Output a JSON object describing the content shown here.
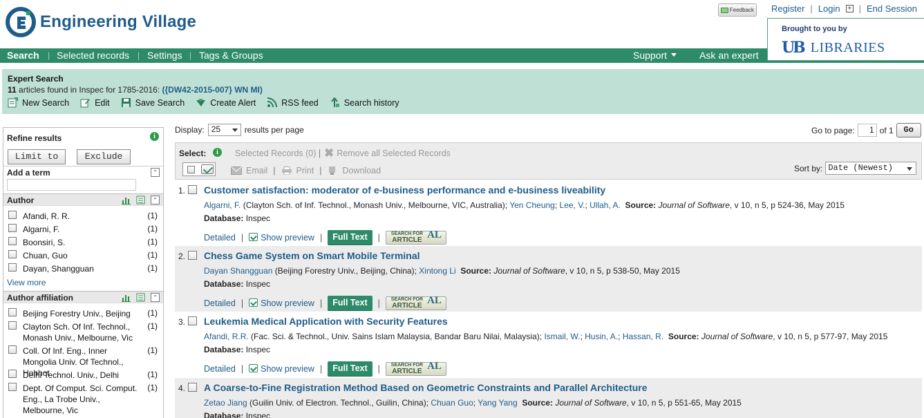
{
  "header": {
    "logo_text": "Engineering Village",
    "feedback_label": "Feedback",
    "user_links": {
      "register": "Register",
      "login": "Login",
      "plus": "+",
      "end_session": "End Session"
    },
    "brought_by": "Brought to you by",
    "library_mark": "UB",
    "library_name": "LIBRARIES"
  },
  "nav": {
    "search": "Search",
    "selected_records": "Selected records",
    "settings": "Settings",
    "tags_groups": "Tags & Groups",
    "support": "Support",
    "ask_expert": "Ask an expert",
    "separator": "|"
  },
  "expert": {
    "title": "Expert Search",
    "count": "11",
    "found_text": " articles found in Inspec for 1785-2016: ",
    "query": "({DW42-2015-007} WN MI)",
    "actions": [
      {
        "label": "New Search",
        "icon": "new-search-icon"
      },
      {
        "label": "Edit",
        "icon": "edit-icon"
      },
      {
        "label": "Save Search",
        "icon": "save-icon"
      },
      {
        "label": "Create Alert",
        "icon": "alert-icon"
      },
      {
        "label": "RSS feed",
        "icon": "rss-icon"
      },
      {
        "label": "Search history",
        "icon": "history-icon"
      }
    ]
  },
  "refine": {
    "title": "Refine results",
    "info": "i",
    "limit_to": "Limit to",
    "exclude": "Exclude",
    "add_term": "Add a term",
    "add_term_value": "",
    "author": {
      "title": "Author",
      "items": [
        {
          "label": "Afandi, R. R.",
          "count": "(1)"
        },
        {
          "label": "Algarni, F.",
          "count": "(1)"
        },
        {
          "label": "Boonsiri, S.",
          "count": "(1)"
        },
        {
          "label": "Chuan, Guo",
          "count": "(1)"
        },
        {
          "label": "Dayan, Shangguan",
          "count": "(1)"
        }
      ],
      "view_more": "View more"
    },
    "affiliation": {
      "title": "Author affiliation",
      "items": [
        {
          "label": "Beijing Forestry Univ., Beijing",
          "count": "(1)"
        },
        {
          "label": "Clayton Sch. Of Inf. Technol., Monash Univ., Melbourne, Vic",
          "count": "(1)"
        },
        {
          "label": "Coll. Of Inf. Eng., Inner Mongolia Univ. Of Technol., Hohhot",
          "count": "(1)"
        },
        {
          "label": "Delhi Technol. Univ., Delhi",
          "count": "(1)"
        },
        {
          "label": "Dept. Of Comput. Sci. Comput. Eng., La Trobe Univ., Melbourne, Vic",
          "count": "(1)"
        }
      ]
    }
  },
  "results_toolbar": {
    "display_label": "Display:",
    "display_value": "25",
    "per_page": "results per page",
    "goto_label": "Go to page:",
    "goto_value": "1",
    "of_pages": "of 1",
    "go": "Go",
    "select_label": "Select:",
    "selected_records": "Selected Records (0)",
    "separator": "|",
    "remove_all": "Remove all Selected Records",
    "email": "Email",
    "print": "Print",
    "download": "Download",
    "sort_label": "Sort by:",
    "sort_value": "Date (Newest)"
  },
  "results": [
    {
      "num": "1.",
      "title": "Customer satisfaction: moderator of e-business performance and e-business liveability",
      "author1": "Algarni, F.",
      "aff1": " (Clayton Sch. of Inf. Technol., Monash Univ., Melbourne, VIC, Australia);",
      "others": [
        "Yen Cheung",
        "Lee, V.",
        "Ullah, A."
      ],
      "source_label": "Source:",
      "journal": "Journal of Software",
      "citation": ", v 10, n 5, p 524-36, May 2015",
      "db_label": "Database:",
      "db": "Inspec"
    },
    {
      "num": "2.",
      "title": "Chess Game System on Smart Mobile Terminal",
      "author1": "Dayan Shangguan",
      "aff1": " (Beijing Forestry Univ., Beijing, China);",
      "others": [
        "Xintong Li"
      ],
      "source_label": "Source:",
      "journal": "Journal of Software",
      "citation": ", v 10, n 5, p 538-50, May 2015",
      "db_label": "Database:",
      "db": "Inspec"
    },
    {
      "num": "3.",
      "title": "Leukemia Medical Application with Security Features",
      "author1": "Afandi, R.R.",
      "aff1": " (Fac. Sci. & Technol., Univ. Sains Islam Malaysia, Bandar Baru Nilai, Malaysia);",
      "others": [
        "Ismail, W.",
        "Husin, A.",
        "Hassan, R."
      ],
      "source_label": "Source:",
      "journal": "Journal of Software",
      "citation": ", v 10, n 5, p 577-97, May 2015",
      "db_label": "Database:",
      "db": "Inspec"
    },
    {
      "num": "4.",
      "title": "A Coarse-to-Fine Registration Method Based on Geometric Constraints and Parallel Architecture",
      "author1": "Zetao Jiang",
      "aff1": " (Guilin Univ. of Electron. Technol., Guilin, China);",
      "others": [
        "Chuan Guo",
        "Yang Yang"
      ],
      "source_label": "Source:",
      "journal": "Journal of Software",
      "citation": ", v 10, n 5, p 551-65, May 2015",
      "db_label": "Database:",
      "db": "Inspec"
    }
  ],
  "result_actions": {
    "detailed": "Detailed",
    "show_preview": "Show preview",
    "full_text": "Full Text",
    "sfa_top": "SEARCH FOR",
    "sfa_bottom": "ARTICLE",
    "sfa_mark": "AL",
    "separator": "|"
  },
  "colors": {
    "brand_green": "#2e8b6a",
    "link_blue": "#1f5c8a",
    "expert_bg": "#bfe0d4"
  }
}
